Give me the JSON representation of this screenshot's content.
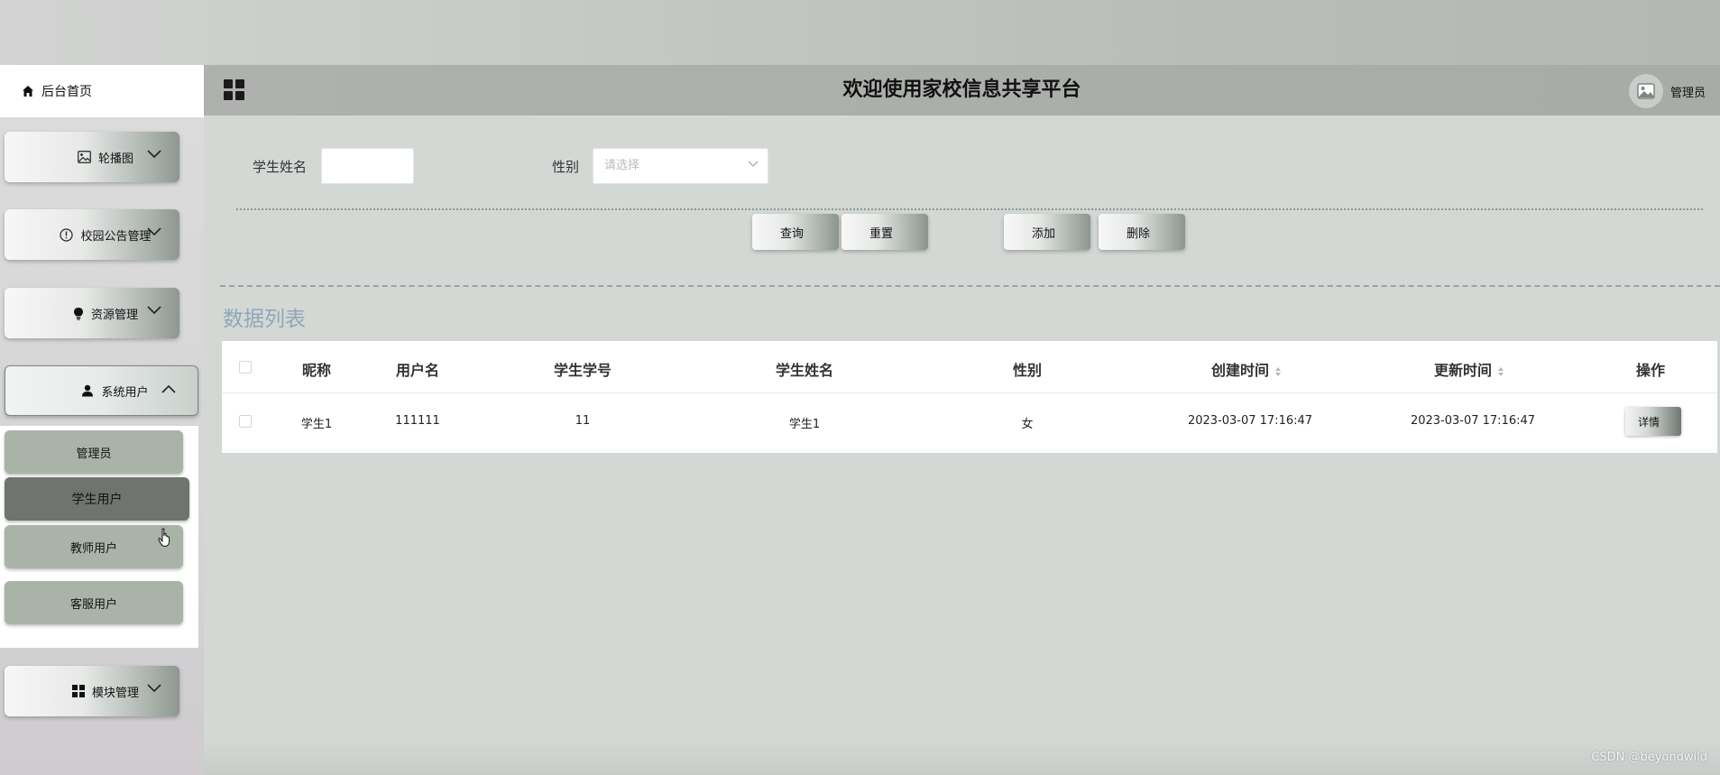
{
  "header": {
    "title": "欢迎使用家校信息共享平台",
    "user_name": "管理员"
  },
  "sidebar": {
    "home_label": "后台首页",
    "menus": [
      {
        "label": "轮播图",
        "icon": "image-icon"
      },
      {
        "label": "校园公告管理",
        "icon": "info-circle-icon"
      },
      {
        "label": "资源管理",
        "icon": "bulb-icon"
      },
      {
        "label": "系统用户",
        "icon": "user-icon"
      },
      {
        "label": "模块管理",
        "icon": "grid-icon"
      }
    ],
    "submenu": [
      {
        "label": "管理员"
      },
      {
        "label": "学生用户"
      },
      {
        "label": "教师用户"
      },
      {
        "label": "客服用户"
      }
    ]
  },
  "search": {
    "name_label": "学生姓名",
    "name_value": "",
    "gender_label": "性别",
    "gender_placeholder": "请选择"
  },
  "actions": {
    "query": "查询",
    "reset": "重置",
    "add": "添加",
    "delete": "删除"
  },
  "list": {
    "title": "数据列表",
    "columns": [
      "昵称",
      "用户名",
      "学生学号",
      "学生姓名",
      "性别",
      "创建时间",
      "更新时间",
      "操作"
    ],
    "rows": [
      {
        "nickname": "学生1",
        "username": "111111",
        "student_no": "11",
        "student_name": "学生1",
        "gender": "女",
        "created": "2023-03-07 17:16:47",
        "updated": "2023-03-07 17:16:47",
        "action": "详情"
      }
    ]
  },
  "watermark": "CSDN @beyondwild"
}
